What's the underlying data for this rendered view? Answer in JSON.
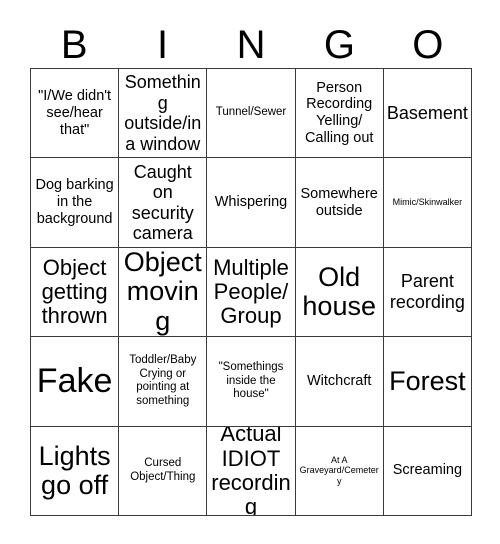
{
  "card": {
    "title_letters": [
      "B",
      "I",
      "N",
      "G",
      "O"
    ],
    "border_color": "#3a3a3a",
    "background_color": "#ffffff",
    "text_color": "#000000",
    "columns": 5,
    "rows": 5,
    "cells": [
      {
        "text": "\"I/We didn't see/hear that\"",
        "size": "md"
      },
      {
        "text": "Something outside/in a window",
        "size": "lg"
      },
      {
        "text": "Tunnel/Sewer",
        "size": "sm"
      },
      {
        "text": "Person Recording Yelling/ Calling out",
        "size": "md"
      },
      {
        "text": "Basement",
        "size": "lg"
      },
      {
        "text": "Dog barking in the background",
        "size": "md"
      },
      {
        "text": "Caught on security camera",
        "size": "lg"
      },
      {
        "text": "Whispering",
        "size": "md"
      },
      {
        "text": "Somewhere outside",
        "size": "md"
      },
      {
        "text": "Mimic/Skinwalker",
        "size": "xs"
      },
      {
        "text": "Object getting thrown",
        "size": "xl"
      },
      {
        "text": "Object moving",
        "size": "xxl"
      },
      {
        "text": "Multiple People/ Group",
        "size": "xl"
      },
      {
        "text": "Old house",
        "size": "xxl"
      },
      {
        "text": "Parent recording",
        "size": "lg"
      },
      {
        "text": "Fake",
        "size": "huge"
      },
      {
        "text": "Toddler/Baby Crying or pointing at something",
        "size": "sm"
      },
      {
        "text": "\"Somethings inside the house\"",
        "size": "sm"
      },
      {
        "text": "Witchcraft",
        "size": "md"
      },
      {
        "text": "Forest",
        "size": "xxl"
      },
      {
        "text": "Lights go off",
        "size": "xxl"
      },
      {
        "text": "Cursed Object/Thing",
        "size": "sm"
      },
      {
        "text": "Actual IDIOT recording",
        "size": "xl"
      },
      {
        "text": "At A Graveyard/Cemetery",
        "size": "xs"
      },
      {
        "text": "Screaming",
        "size": "md"
      }
    ]
  }
}
